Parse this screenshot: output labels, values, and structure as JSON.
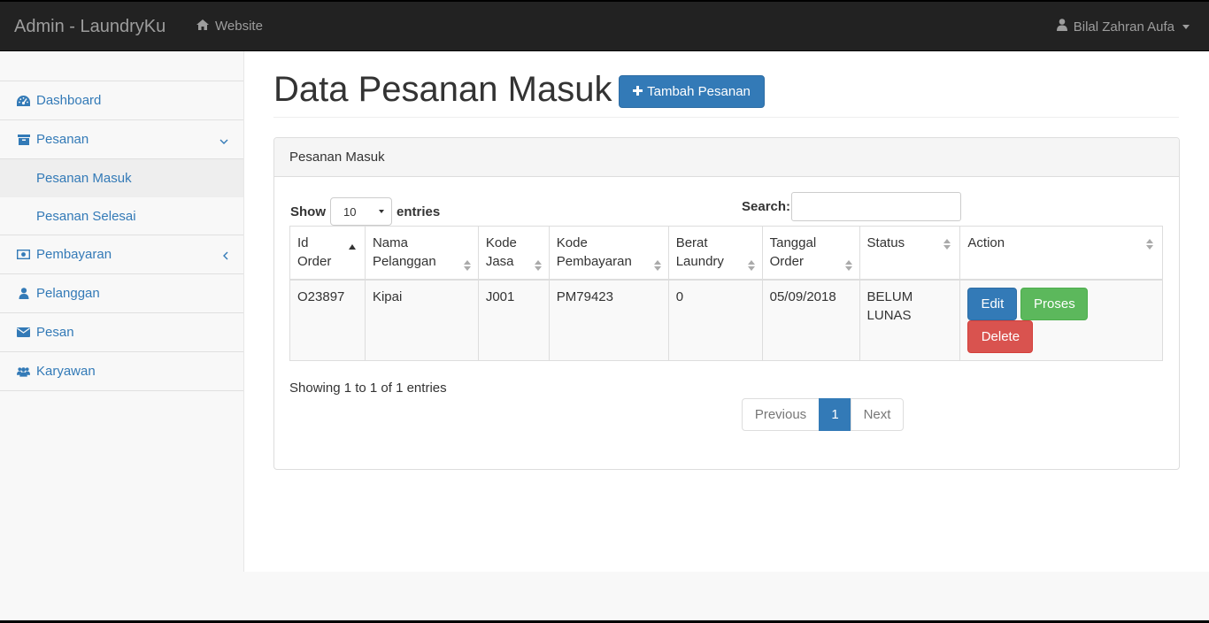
{
  "navbar": {
    "brand": "Admin - LaundryKu",
    "website_link": "Website",
    "user_name": "Bilal Zahran Aufa",
    "icons": {
      "website": "home-icon",
      "user": "user-icon",
      "dropdown": "caret-down-icon"
    }
  },
  "sidebar": {
    "items": [
      {
        "label": "Dashboard",
        "icon": "dashboard-icon"
      },
      {
        "label": "Pesanan",
        "icon": "archive-icon",
        "expanded": true,
        "children": [
          {
            "label": "Pesanan Masuk",
            "active": true
          },
          {
            "label": "Pesanan Selesai",
            "active": false
          }
        ]
      },
      {
        "label": "Pembayaran",
        "icon": "money-icon"
      },
      {
        "label": "Pelanggan",
        "icon": "user-icon"
      },
      {
        "label": "Pesan",
        "icon": "envelope-icon"
      },
      {
        "label": "Karyawan",
        "icon": "users-icon"
      }
    ]
  },
  "page": {
    "title": "Data Pesanan Masuk",
    "add_button": "Tambah Pesanan"
  },
  "panel": {
    "heading": "Pesanan Masuk",
    "length": {
      "show": "Show",
      "value": "10",
      "entries": "entries"
    },
    "search_label": "Search:",
    "search_value": ""
  },
  "table": {
    "columns": [
      {
        "line1": "Id Order",
        "line2": "",
        "sort": "asc"
      },
      {
        "line1": "Nama",
        "line2": "Pelanggan",
        "sort": "both"
      },
      {
        "line1": "Kode",
        "line2": "Jasa",
        "sort": "both"
      },
      {
        "line1": "Kode",
        "line2": "Pembayaran",
        "sort": "both"
      },
      {
        "line1": "Berat",
        "line2": "Laundry",
        "sort": "both"
      },
      {
        "line1": "Tanggal",
        "line2": "Order",
        "sort": "both"
      },
      {
        "line1": "Status",
        "line2": "",
        "sort": "both"
      },
      {
        "line1": "Action",
        "line2": "",
        "sort": "both"
      }
    ],
    "rows": [
      {
        "id_order": "O23897",
        "nama_pelanggan": "Kipai",
        "kode_jasa": "J001",
        "kode_pembayaran": "PM79423",
        "berat_laundry": "0",
        "tanggal_order": "05/09/2018",
        "status_line1": "BELUM",
        "status_line2": "LUNAS",
        "actions": {
          "edit": "Edit",
          "proses": "Proses",
          "delete": "Delete"
        }
      }
    ]
  },
  "footer": {
    "info": "Showing 1 to 1 of 1 entries",
    "pagination": {
      "previous": "Previous",
      "current": "1",
      "next": "Next"
    }
  },
  "colors": {
    "navbar_bg": "#222222",
    "link": "#337ab7",
    "primary": "#337ab7",
    "success": "#5cb85c",
    "danger": "#d9534f"
  }
}
